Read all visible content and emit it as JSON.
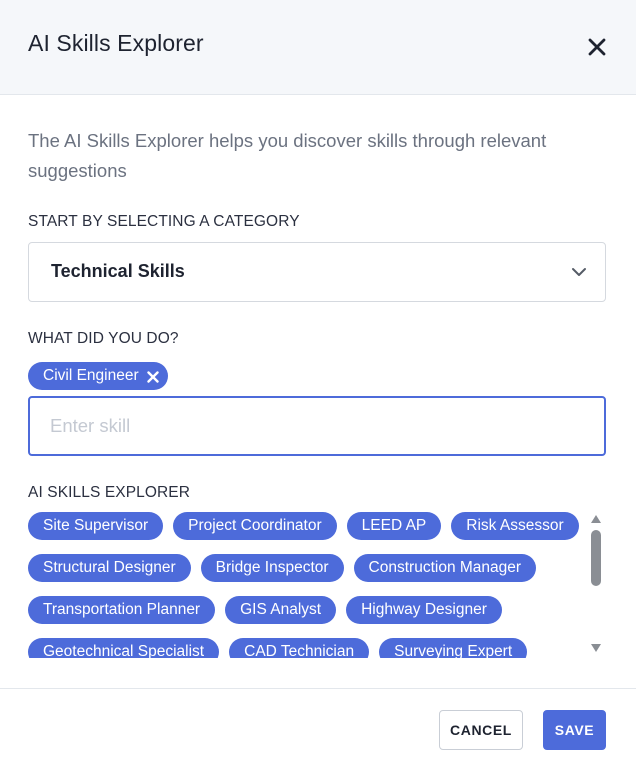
{
  "dialog": {
    "title": "AI Skills Explorer",
    "close_icon": "close-icon",
    "description": "The AI Skills Explorer helps you discover skills through relevant suggestions"
  },
  "category": {
    "label": "START BY SELECTING A CATEGORY",
    "selected": "Technical Skills",
    "icon": "chevron-down-icon"
  },
  "what_did_you_do": {
    "label": "WHAT DID YOU DO?",
    "selected_skills": [
      "Civil Engineer"
    ],
    "input_value": "",
    "input_placeholder": "Enter skill"
  },
  "explorer": {
    "label": "AI SKILLS EXPLORER",
    "rows": [
      [
        "Site Supervisor",
        "Project Coordinator",
        "LEED AP",
        "Risk Assessor"
      ],
      [
        "Structural Designer",
        "Bridge Inspector",
        "Construction Manager"
      ],
      [
        "Transportation Planner",
        "GIS Analyst",
        "Highway Designer"
      ],
      [
        "Geotechnical Specialist",
        "CAD Technician",
        "Surveying Expert"
      ]
    ]
  },
  "footer": {
    "cancel_label": "CANCEL",
    "save_label": "SAVE"
  },
  "colors": {
    "accent": "#4d6bda",
    "header_bg": "#f5f7fa",
    "text_dark": "#1e2330",
    "text_muted": "#6b7280"
  }
}
